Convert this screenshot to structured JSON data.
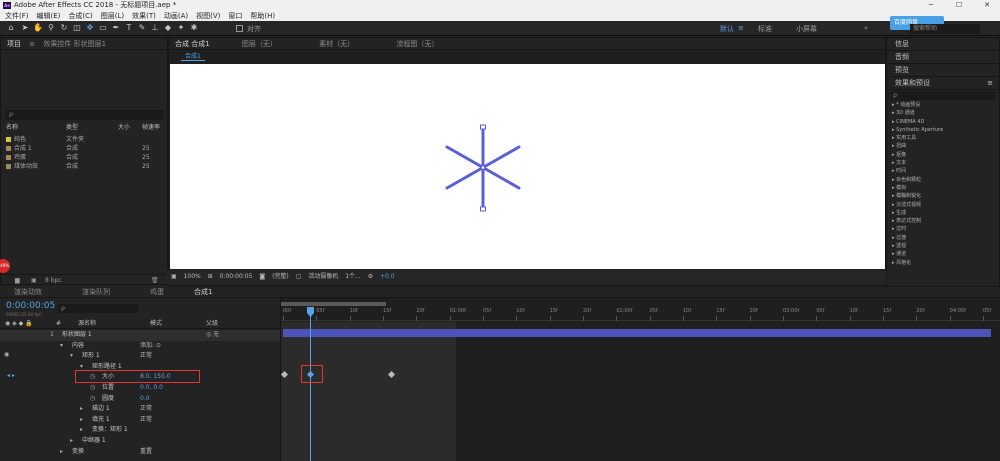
{
  "window": {
    "title": "Adobe After Effects CC 2018 - 无标题项目.aep *",
    "logo": "Ae",
    "minimize": "─",
    "maximize": "☐",
    "close": "✕"
  },
  "menu": [
    "文件(F)",
    "编辑(E)",
    "合成(C)",
    "图层(L)",
    "效果(T)",
    "动画(A)",
    "视图(V)",
    "窗口",
    "帮助(H)"
  ],
  "toolbar": {
    "align_label": "对齐",
    "workspaces": [
      "默认",
      "标准",
      "小屏幕"
    ],
    "menu_glyph": "»",
    "cloud_label": "百度网盘",
    "search_placeholder": "搜索帮助"
  },
  "project_panel": {
    "tab": "项目",
    "tab_menu": "≡",
    "effect_controls_tab": "效果控件 形状图层1",
    "search_icon": "ρ·",
    "columns": {
      "name": "名称",
      "type": "类型",
      "size": "大小",
      "fps": "帧速率"
    },
    "rows": [
      {
        "name": "纯色",
        "type": "文件夹",
        "size": "",
        "fps": "",
        "color": "#d6c44a"
      },
      {
        "name": "合成 1",
        "type": "合成",
        "size": "",
        "fps": "25",
        "color": "#a08a5a"
      },
      {
        "name": "鸡蛋",
        "type": "合成",
        "size": "",
        "fps": "25",
        "color": "#a08a5a"
      },
      {
        "name": "煤体动效",
        "type": "合成",
        "size": "",
        "fps": "25",
        "color": "#a08a5a"
      }
    ],
    "bpc": "8 bpc"
  },
  "viewer": {
    "tabs": [
      "合成 合成1",
      "图层（无）",
      "素材（无）",
      "流程图（无）"
    ],
    "crumb": "合成1",
    "zoom": "100%",
    "timecode": "0:00:00:05",
    "resolution": "(完整)",
    "camera": "活动摄像机",
    "views": "1个...",
    "exposure": "+0.0"
  },
  "right_panel": {
    "items": [
      "信息",
      "音频",
      "预览",
      "效果和预设"
    ],
    "search_icon": "ρ·",
    "menu_glyph": "≡",
    "effects": [
      "* 动画预设",
      "3D 通道",
      "CINEMA 4D",
      "Synthetic Aperture",
      "实用工具",
      "扭曲",
      "抠像",
      "文本",
      "时间",
      "杂色和颗粒",
      "模拟",
      "模糊和锐化",
      "沉浸式视频",
      "生成",
      "表达式控制",
      "过时",
      "过渡",
      "透视",
      "通道",
      "风格化"
    ]
  },
  "timeline": {
    "tabs": [
      "渲染动效",
      "渲染队列",
      "鸡蛋",
      "合成1"
    ],
    "timecode": "0:00:00:05",
    "frame_info": "00005 (25.00 fps)",
    "search_icon": "ρ·",
    "header": {
      "num": "#",
      "name": "源名称",
      "mode": "模式",
      "parent": "父级"
    },
    "ruler": [
      "00f",
      "05f",
      "10f",
      "15f",
      "20f",
      "01:00f",
      "05f",
      "10f",
      "15f",
      "20f",
      "02:00f",
      "05f",
      "10f",
      "15f",
      "20f",
      "03:00f",
      "05f",
      "10f",
      "15f",
      "20f",
      "04:00f",
      "05f"
    ],
    "layers": [
      {
        "indent": 0,
        "label": "1",
        "name": "形状图层 1",
        "mode": "",
        "extra": "◎ 无"
      },
      {
        "indent": 1,
        "label": "▾",
        "name": "内容",
        "mode": "添加: ⊙",
        "extra": ""
      },
      {
        "indent": 2,
        "label": "▾",
        "name": "矩形 1",
        "mode": "正常",
        "extra": ""
      },
      {
        "indent": 3,
        "label": "▾",
        "name": "矩形路径 1",
        "mode": "",
        "extra": ""
      },
      {
        "indent": 4,
        "label": "◷",
        "name": "大小",
        "mode": "8.0, 150.0",
        "extra": ""
      },
      {
        "indent": 4,
        "label": "◷",
        "name": "位置",
        "mode": "0.0, 0.0",
        "extra": ""
      },
      {
        "indent": 4,
        "label": "◷",
        "name": "圆度",
        "mode": "0.0",
        "extra": ""
      },
      {
        "indent": 3,
        "label": "▸",
        "name": "描边 1",
        "mode": "正常",
        "extra": ""
      },
      {
        "indent": 3,
        "label": "▸",
        "name": "填充 1",
        "mode": "正常",
        "extra": ""
      },
      {
        "indent": 3,
        "label": "▸",
        "name": "变换：矩形 1",
        "mode": "",
        "extra": ""
      },
      {
        "indent": 2,
        "label": "▸",
        "name": "中继器 1",
        "mode": "",
        "extra": ""
      },
      {
        "indent": 1,
        "label": "▸",
        "name": "变换",
        "mode": "重置",
        "extra": ""
      }
    ]
  },
  "misc": {
    "red_badge": "48%",
    "glyph_eye": "◉",
    "glyph_kf": "◆",
    "glyph_lr": "◂ ▸"
  },
  "colors": {
    "accent": "#5aa1e6",
    "shape": "#5b5fd6",
    "highlight": "#e63434",
    "layer_bar": "#4d53b9"
  }
}
